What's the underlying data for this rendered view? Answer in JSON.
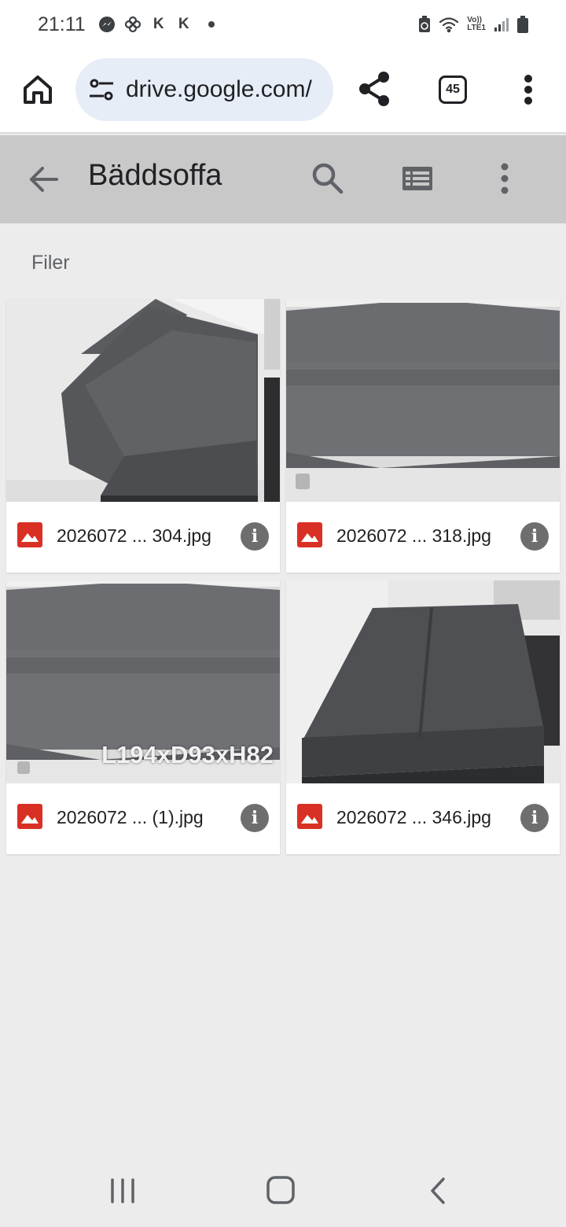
{
  "status_bar": {
    "time": "21:11",
    "notification_icons": [
      "messenger-icon",
      "pinwheel-icon",
      "k-app-icon",
      "k-app-icon",
      "dot-icon"
    ],
    "k_label": "K",
    "network_label_top": "Vo))",
    "network_label_bottom": "LTE1"
  },
  "browser": {
    "url": "drive.google.com/",
    "tab_count": "45"
  },
  "app_bar": {
    "title": "Bäddsoffa"
  },
  "section": {
    "label": "Filer"
  },
  "files": [
    {
      "name": "2026072 ... 304.jpg",
      "overlay": ""
    },
    {
      "name": "2026072 ... 318.jpg",
      "overlay": ""
    },
    {
      "name": "2026072 ... (1).jpg",
      "overlay": "L194xD93xH82"
    },
    {
      "name": "2026072 ... 346.jpg",
      "overlay": ""
    }
  ],
  "colors": {
    "image_icon": "#d93025",
    "app_bar": "#c8c8c8",
    "background": "#ececec",
    "url_pill": "#e7edf6"
  }
}
